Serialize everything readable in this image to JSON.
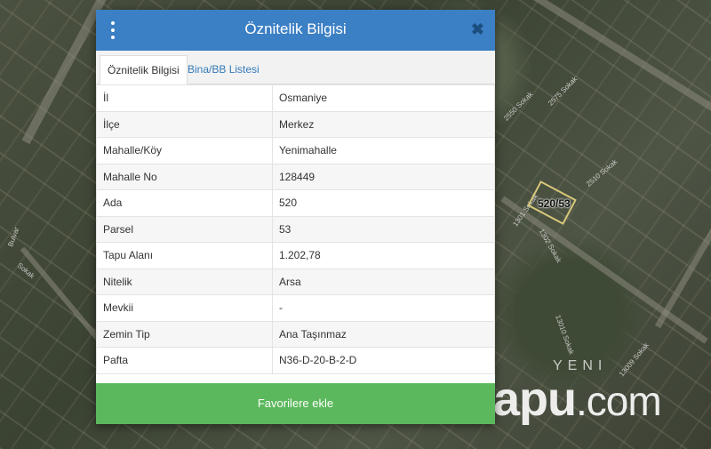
{
  "map": {
    "parcel_label": "520/53",
    "street_labels": [
      "2550 Sokak",
      "2575 Sokak",
      "2510 Sokak",
      "1301 Sokak",
      "1302 Sokak",
      "13010 Sokak",
      "13009 Sokak",
      "Bulvar",
      "Sokak"
    ],
    "area_label": "YENI",
    "watermark_main": "tapu",
    "watermark_suffix": ".com"
  },
  "modal": {
    "title": "Öznitelik Bilgisi",
    "close_glyph": "✖",
    "tabs": [
      {
        "label": "Öznitelik Bilgisi",
        "active": true
      },
      {
        "label": "Bina/BB Listesi",
        "active": false
      }
    ],
    "rows": [
      {
        "key": "İl",
        "value": "Osmaniye"
      },
      {
        "key": "İlçe",
        "value": "Merkez"
      },
      {
        "key": "Mahalle/Köy",
        "value": "Yenimahalle"
      },
      {
        "key": "Mahalle No",
        "value": "128449"
      },
      {
        "key": "Ada",
        "value": "520"
      },
      {
        "key": "Parsel",
        "value": "53"
      },
      {
        "key": "Tapu Alanı",
        "value": "1.202,78"
      },
      {
        "key": "Nitelik",
        "value": "Arsa"
      },
      {
        "key": "Mevkii",
        "value": "-"
      },
      {
        "key": "Zemin Tip",
        "value": "Ana Taşınmaz"
      },
      {
        "key": "Pafta",
        "value": "N36-D-20-B-2-D"
      }
    ],
    "favorite_button": "Favorilere ekle"
  },
  "colors": {
    "header": "#3b7fc4",
    "favorite": "#5cb85c",
    "tab_link": "#337ab7"
  }
}
